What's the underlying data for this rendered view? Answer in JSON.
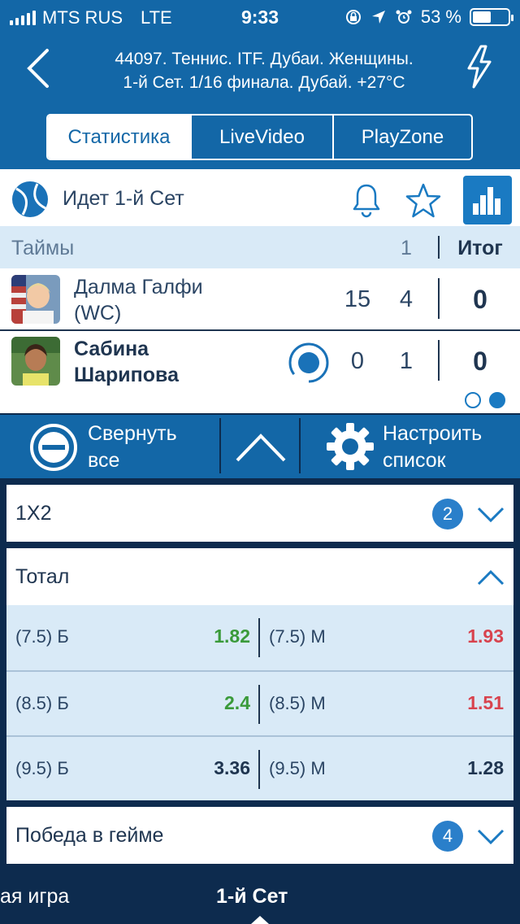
{
  "status_bar": {
    "carrier": "MTS RUS",
    "network": "LTE",
    "time": "9:33",
    "battery": "53 %",
    "battery_level": 0.53
  },
  "header": {
    "title_line1": "44097. Теннис. ITF. Дубаи. Женщины.",
    "title_line2": "1-й  Сет. 1/16 финала. Дубай. +27°C"
  },
  "tabs": [
    {
      "label": "Статистика",
      "active": true
    },
    {
      "label": "LiveVideo",
      "active": false
    },
    {
      "label": "PlayZone",
      "active": false
    }
  ],
  "match": {
    "status": "Идет 1-й  Сет",
    "periods_label": "Таймы",
    "period_col": "1",
    "total_col": "Итог",
    "players": [
      {
        "name_line1": "Далма Галфи",
        "name_line2": "(WC)",
        "game": "15",
        "set1": "4",
        "total": "0",
        "serving": false
      },
      {
        "name_line1": "Сабина",
        "name_line2": "Шарипова",
        "game": "0",
        "set1": "1",
        "total": "0",
        "serving": true
      }
    ]
  },
  "actions": {
    "collapse_line1": "Свернуть",
    "collapse_line2": "все",
    "config_line1": "Настроить",
    "config_line2": "список"
  },
  "markets": {
    "m1x2": {
      "name": "1X2",
      "count": "2"
    },
    "total": {
      "name": "Тотал",
      "rows": [
        {
          "left_label": "(7.5) Б",
          "left_odds": "1.82",
          "left_trend": "up",
          "right_label": "(7.5) М",
          "right_odds": "1.93",
          "right_trend": "down"
        },
        {
          "left_label": "(8.5) Б",
          "left_odds": "2.4",
          "left_trend": "up",
          "right_label": "(8.5) М",
          "right_odds": "1.51",
          "right_trend": "down"
        },
        {
          "left_label": "(9.5) Б",
          "left_odds": "3.36",
          "left_trend": "neutral",
          "right_label": "(9.5) М",
          "right_odds": "1.28",
          "right_trend": "neutral"
        }
      ]
    },
    "game_win": {
      "name": "Победа в гейме",
      "count": "4"
    }
  },
  "bottom_tabs": [
    {
      "label": "ая игра",
      "active": false
    },
    {
      "label": "1-й  Сет",
      "active": true
    }
  ],
  "colors": {
    "brand_blue": "#1367a7",
    "dark_navy": "#0d2b4e",
    "odds_up": "#3a9a3a",
    "odds_down": "#d8434e"
  }
}
